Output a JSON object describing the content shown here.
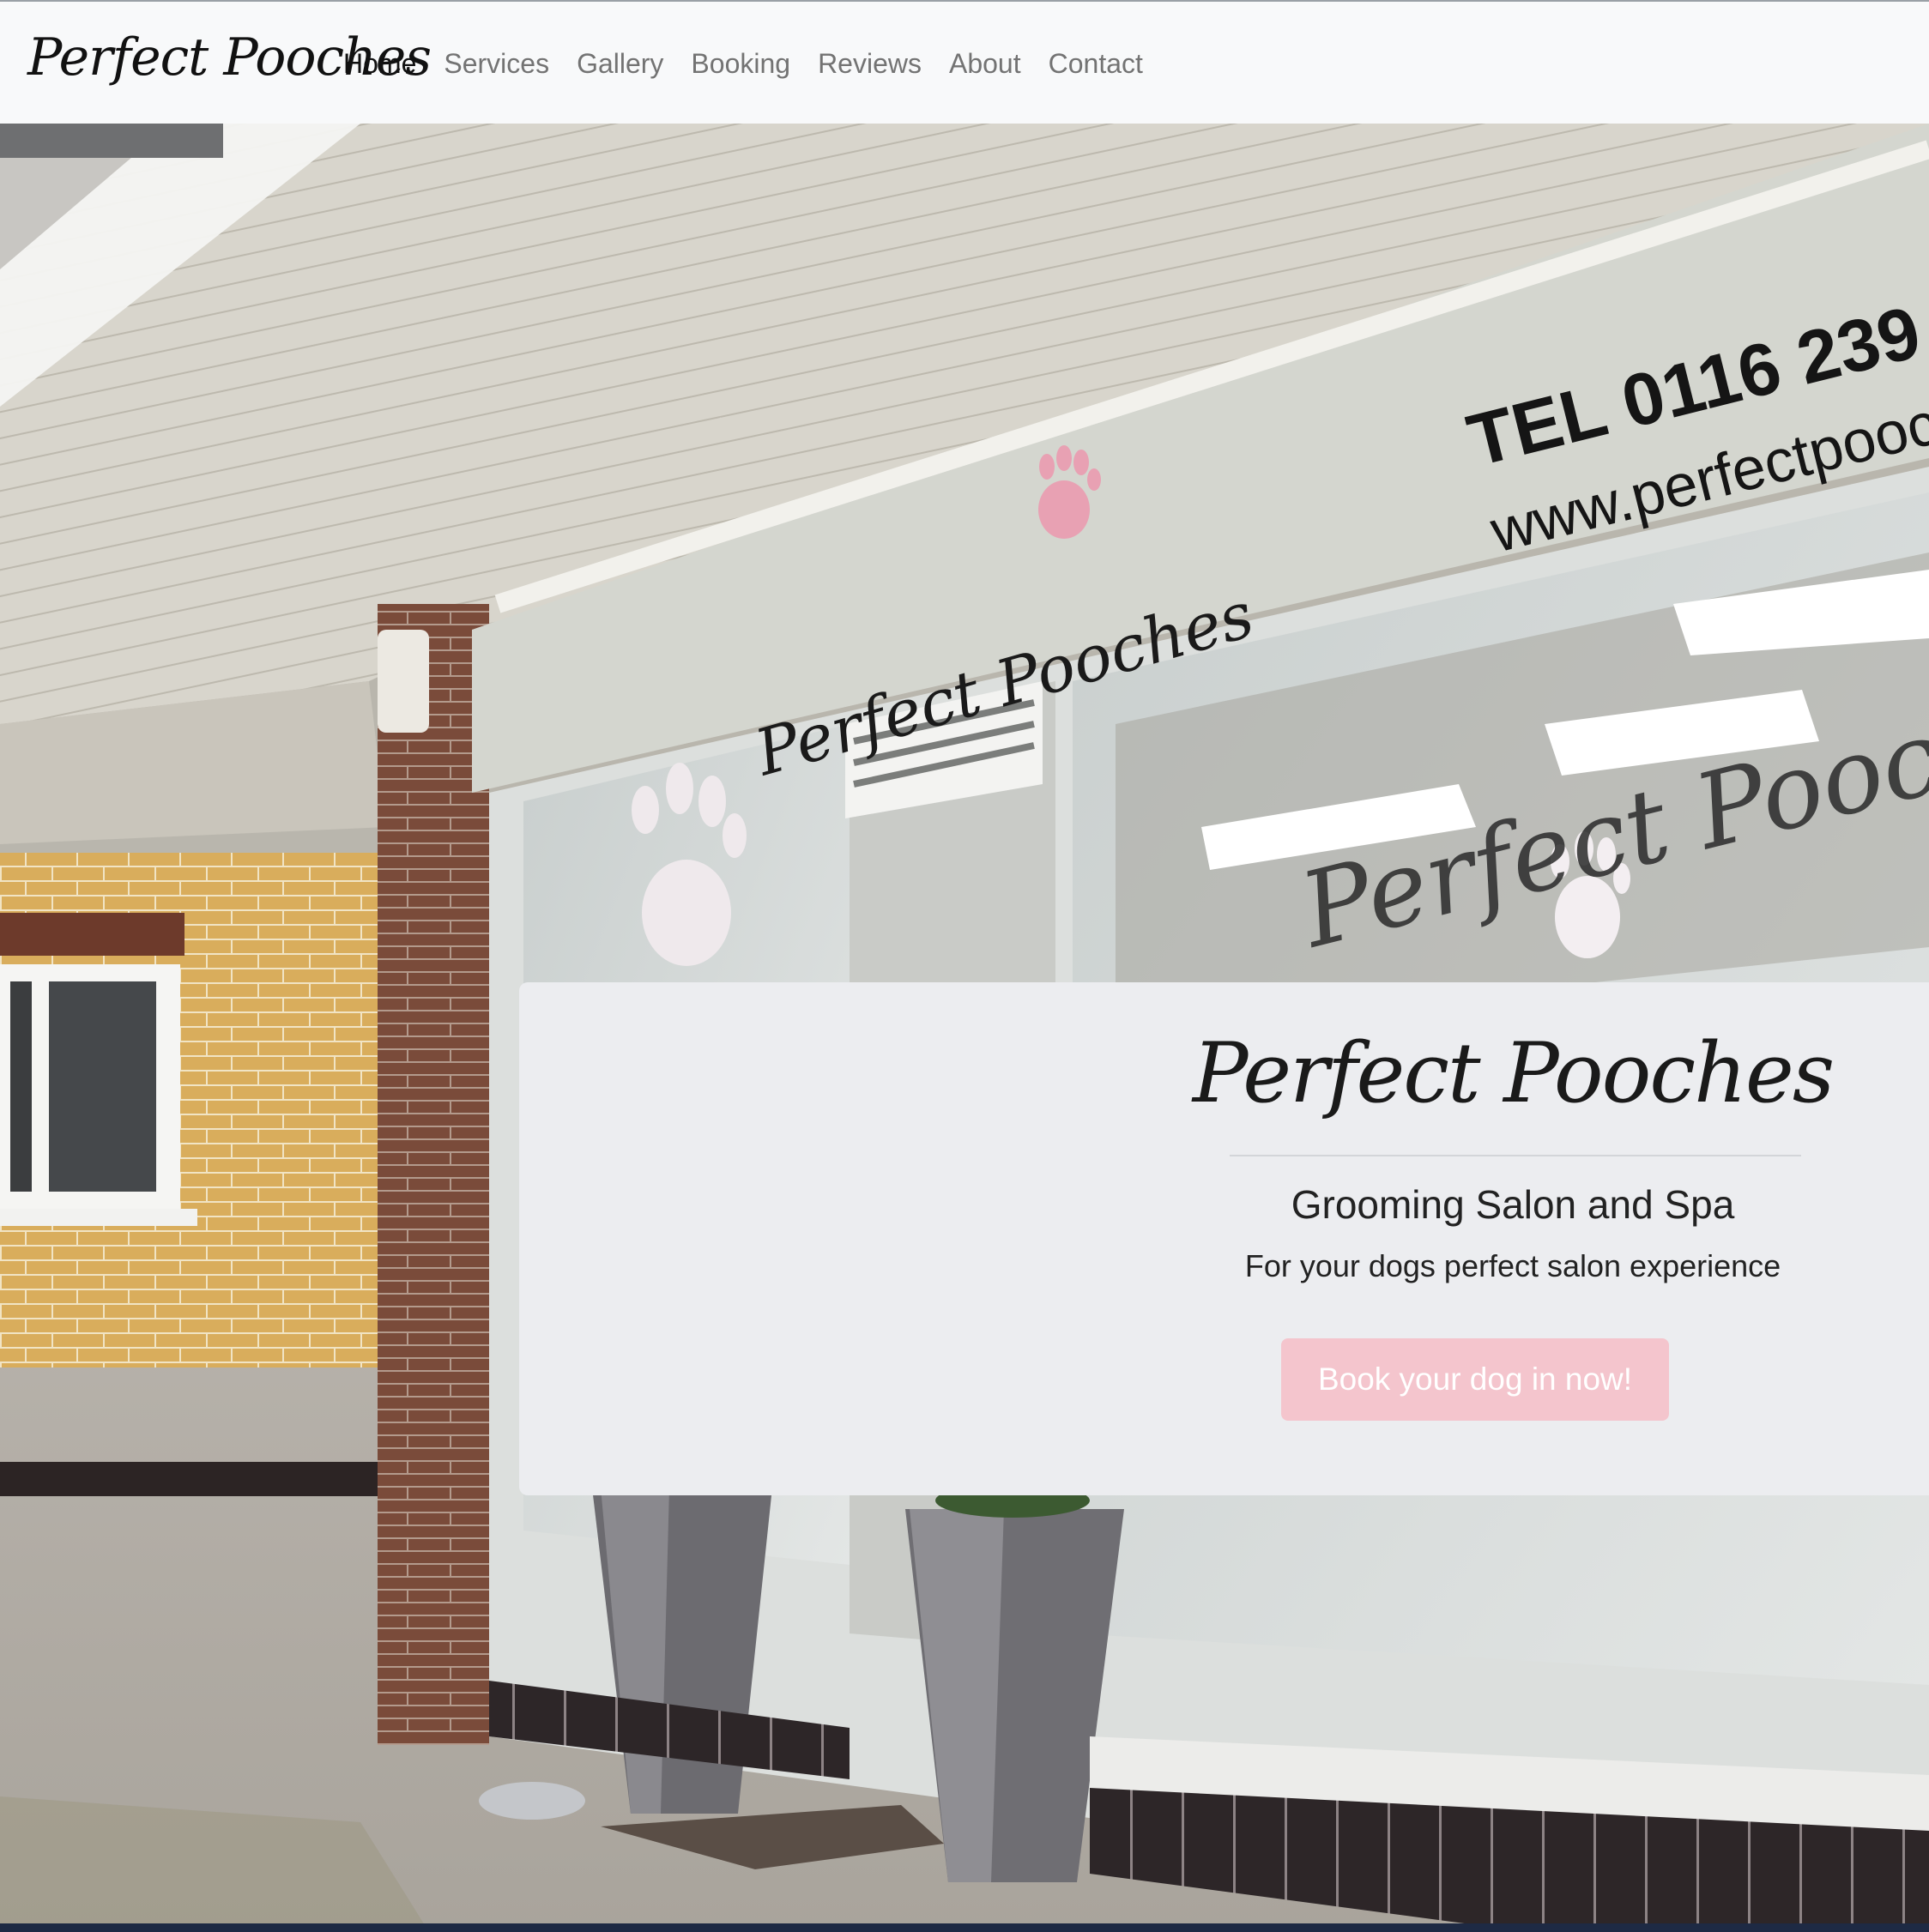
{
  "navbar": {
    "brand": "Perfect Pooches",
    "links": [
      {
        "label": "Home",
        "active": true
      },
      {
        "label": "Services",
        "active": false
      },
      {
        "label": "Gallery",
        "active": false
      },
      {
        "label": "Booking",
        "active": false
      },
      {
        "label": "Reviews",
        "active": false
      },
      {
        "label": "About",
        "active": false
      },
      {
        "label": "Contact",
        "active": false
      }
    ]
  },
  "hero_photo": {
    "signage": {
      "tel_text": "TEL 0116 239",
      "web_text": "www.perfectpooch",
      "fascia_logo": "Perfect Pooches",
      "window_logo": "Perfect Pooches"
    }
  },
  "jumbotron": {
    "title": "Perfect Pooches",
    "subtitle": "Grooming Salon and Spa",
    "lead": "For your dogs perfect salon experience",
    "cta_label": "Book your dog in now!"
  },
  "colors": {
    "navbar_bg": "#f8f9fa",
    "nav_active": "#111111",
    "nav_inactive": "#737373",
    "jumbotron_bg": "#ecedf0",
    "cta_bg": "#f4c5cd",
    "cta_text": "#ffffff",
    "accent_pink": "#e8a1b3"
  }
}
